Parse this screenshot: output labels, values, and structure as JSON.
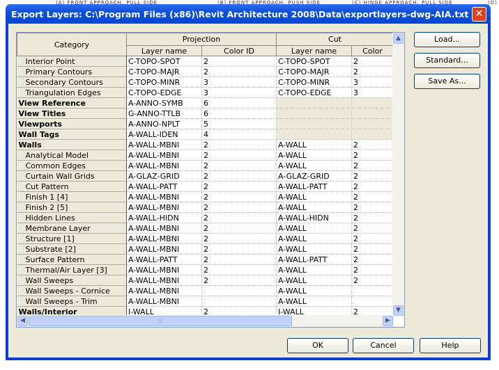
{
  "background": {
    "labels": [
      "(A) FRONT APPROACH, PULL SIDE",
      "(B) FRONT APPROACH, PUSH SIDE",
      "(C) HINGE APPROACH, PULL SIDE",
      "(D)"
    ]
  },
  "dialog": {
    "title": "Export Layers: C:\\Program Files (x86)\\Revit Architecture 2008\\Data\\exportlayers-dwg-AIA.txt",
    "close_icon": "close-icon"
  },
  "table": {
    "headers": {
      "category": "Category",
      "projection": "Projection",
      "cut": "Cut",
      "layer_name": "Layer name",
      "color_id": "Color ID",
      "cut_color": "Color"
    },
    "rows": [
      {
        "category": "Interior Point",
        "bold": false,
        "proj_layer": "C-TOPO-SPOT",
        "proj_color": "2",
        "cut_layer": "C-TOPO-SPOT",
        "cut_color": "2"
      },
      {
        "category": "Primary Contours",
        "bold": false,
        "proj_layer": "C-TOPO-MAJR",
        "proj_color": "2",
        "cut_layer": "C-TOPO-MAJR",
        "cut_color": "2"
      },
      {
        "category": "Secondary Contours",
        "bold": false,
        "proj_layer": "C-TOPO-MINR",
        "proj_color": "3",
        "cut_layer": "C-TOPO-MINR",
        "cut_color": "3"
      },
      {
        "category": "Triangulation Edges",
        "bold": false,
        "proj_layer": "C-TOPO-EDGE",
        "proj_color": "3",
        "cut_layer": "C-TOPO-EDGE",
        "cut_color": "3"
      },
      {
        "category": "View Reference",
        "bold": true,
        "proj_layer": "A-ANNO-SYMB",
        "proj_color": "6",
        "cut_layer": "",
        "cut_color": "",
        "cut_disabled": true
      },
      {
        "category": "View Titles",
        "bold": true,
        "proj_layer": "G-ANNO-TTLB",
        "proj_color": "6",
        "cut_layer": "",
        "cut_color": "",
        "cut_disabled": true
      },
      {
        "category": "Viewports",
        "bold": true,
        "proj_layer": "A-ANNO-NPLT",
        "proj_color": "5",
        "cut_layer": "",
        "cut_color": "",
        "cut_disabled": true
      },
      {
        "category": "Wall Tags",
        "bold": true,
        "proj_layer": "A-WALL-IDEN",
        "proj_color": "4",
        "cut_layer": "",
        "cut_color": "",
        "cut_disabled": true
      },
      {
        "category": "Walls",
        "bold": true,
        "proj_layer": "A-WALL-MBNI",
        "proj_color": "2",
        "cut_layer": "A-WALL",
        "cut_color": "2"
      },
      {
        "category": "Analytical Model",
        "bold": false,
        "proj_layer": "A-WALL-MBNI",
        "proj_color": "2",
        "cut_layer": "A-WALL",
        "cut_color": "2"
      },
      {
        "category": "Common Edges",
        "bold": false,
        "proj_layer": "A-WALL-MBNI",
        "proj_color": "2",
        "cut_layer": "A-WALL",
        "cut_color": "2"
      },
      {
        "category": "Curtain Wall Grids",
        "bold": false,
        "proj_layer": "A-GLAZ-GRID",
        "proj_color": "2",
        "cut_layer": "A-GLAZ-GRID",
        "cut_color": "2"
      },
      {
        "category": "Cut Pattern",
        "bold": false,
        "proj_layer": "A-WALL-PATT",
        "proj_color": "2",
        "cut_layer": "A-WALL-PATT",
        "cut_color": "2"
      },
      {
        "category": "Finish 1 [4]",
        "bold": false,
        "proj_layer": "A-WALL-MBNI",
        "proj_color": "2",
        "cut_layer": "A-WALL",
        "cut_color": "2"
      },
      {
        "category": "Finish 2 [5]",
        "bold": false,
        "proj_layer": "A-WALL-MBNI",
        "proj_color": "2",
        "cut_layer": "A-WALL",
        "cut_color": "2"
      },
      {
        "category": "Hidden Lines",
        "bold": false,
        "proj_layer": "A-WALL-HIDN",
        "proj_color": "2",
        "cut_layer": "A-WALL-HIDN",
        "cut_color": "2"
      },
      {
        "category": "Membrane Layer",
        "bold": false,
        "proj_layer": "A-WALL-MBNI",
        "proj_color": "2",
        "cut_layer": "A-WALL",
        "cut_color": "2"
      },
      {
        "category": "Structure [1]",
        "bold": false,
        "proj_layer": "A-WALL-MBNI",
        "proj_color": "2",
        "cut_layer": "A-WALL",
        "cut_color": "2"
      },
      {
        "category": "Substrate [2]",
        "bold": false,
        "proj_layer": "A-WALL-MBNI",
        "proj_color": "2",
        "cut_layer": "A-WALL",
        "cut_color": "2"
      },
      {
        "category": "Surface Pattern",
        "bold": false,
        "proj_layer": "A-WALL-PATT",
        "proj_color": "2",
        "cut_layer": "A-WALL-PATT",
        "cut_color": "2"
      },
      {
        "category": "Thermal/Air Layer [3]",
        "bold": false,
        "proj_layer": "A-WALL-MBNI",
        "proj_color": "2",
        "cut_layer": "A-WALL",
        "cut_color": "2"
      },
      {
        "category": "Wall Sweeps",
        "bold": false,
        "proj_layer": "A-WALL-MBNI",
        "proj_color": "2",
        "cut_layer": "A-WALL",
        "cut_color": "2"
      },
      {
        "category": "Wall Sweeps - Cornice",
        "bold": false,
        "proj_layer": "A-WALL-MBNI",
        "proj_color": "",
        "cut_layer": "A-WALL",
        "cut_color": ""
      },
      {
        "category": "Wall Sweeps - Trim",
        "bold": false,
        "proj_layer": "A-WALL-MBNI",
        "proj_color": "",
        "cut_layer": "A-WALL",
        "cut_color": ""
      },
      {
        "category": "Walls/Interior",
        "bold": true,
        "proj_layer": "I-WALL",
        "proj_color": "2",
        "cut_layer": "I-WALL",
        "cut_color": "2"
      }
    ]
  },
  "buttons": {
    "load": "Load...",
    "standard": "Standard...",
    "save_as": "Save As...",
    "ok": "OK",
    "cancel": "Cancel",
    "help": "Help"
  }
}
